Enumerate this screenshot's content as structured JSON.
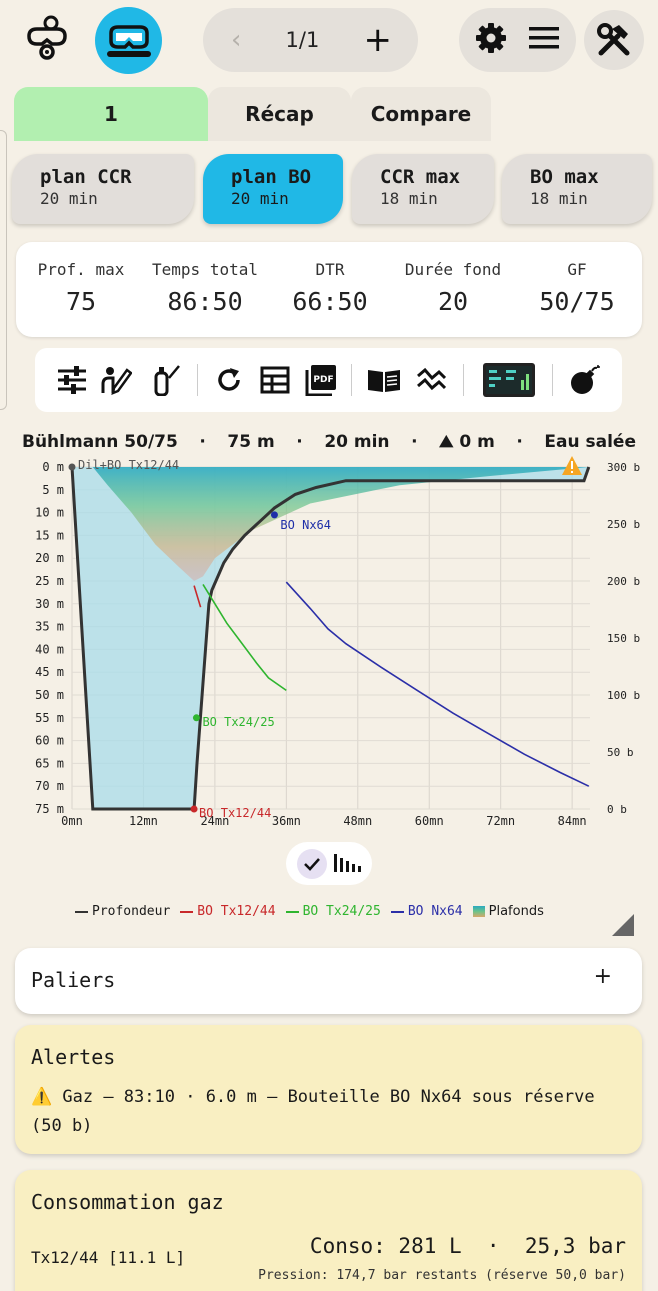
{
  "header": {
    "page_counter": "1/1",
    "prev": "‹",
    "add": "+"
  },
  "tabs": [
    {
      "label": "1",
      "active": true
    },
    {
      "label": "Récap",
      "active": false
    },
    {
      "label": "Compare",
      "active": false
    }
  ],
  "plans": [
    {
      "name": "plan CCR",
      "time": "20 min",
      "active": false
    },
    {
      "name": "plan BO",
      "time": "20 min",
      "active": true
    },
    {
      "name": "CCR max",
      "time": "18 min",
      "active": false
    },
    {
      "name": "BO max",
      "time": "18 min",
      "active": false
    }
  ],
  "stats": [
    {
      "label": "Prof. max",
      "value": "75"
    },
    {
      "label": "Temps total",
      "value": "86:50"
    },
    {
      "label": "DTR",
      "value": "66:50"
    },
    {
      "label": "Durée fond",
      "value": "20"
    },
    {
      "label": "GF",
      "value": "50/75"
    }
  ],
  "chart_header": [
    "Bühlmann 50/75",
    "·",
    "75 m",
    "·",
    "20 min",
    "·",
    "⛰ 0 m",
    "·",
    "Eau salée"
  ],
  "chart_data": {
    "type": "line",
    "x_ticks": [
      "0mn",
      "12mn",
      "24mn",
      "36mn",
      "48mn",
      "60mn",
      "72mn",
      "84mn"
    ],
    "y_ticks_left": [
      "0 m",
      "5 m",
      "10 m",
      "15 m",
      "20 m",
      "25 m",
      "30 m",
      "35 m",
      "40 m",
      "45 m",
      "50 m",
      "55 m",
      "60 m",
      "65 m",
      "70 m",
      "75 m"
    ],
    "y_ticks_right": [
      "300 b",
      "250 b",
      "200 b",
      "150 b",
      "100 b",
      "50 b",
      "0 b"
    ],
    "xlim": [
      0,
      87
    ],
    "ylim_depth": [
      0,
      75
    ],
    "ylim_pressure": [
      0,
      300
    ],
    "series": [
      {
        "name": "Profondeur",
        "color": "#333333",
        "axis": "depth",
        "x": [
          0,
          3.5,
          20.5,
          21,
          23,
          23.5,
          24.5,
          25.5,
          27,
          29,
          31.5,
          34,
          37.5,
          41,
          46,
          52,
          58,
          86,
          86.8
        ],
        "y": [
          0,
          75,
          75,
          65,
          30,
          27,
          24,
          21,
          18,
          15,
          12,
          9,
          6,
          4.5,
          3,
          3,
          3,
          3,
          0
        ]
      },
      {
        "name": "BO Tx12/44",
        "color": "#c8282a",
        "axis": "pressure",
        "x": [
          20.5,
          21.6
        ],
        "y": [
          196,
          177
        ]
      },
      {
        "name": "BO Tx24/25",
        "color": "#2fb52f",
        "axis": "pressure",
        "x": [
          22,
          24,
          26,
          29,
          31,
          33,
          36
        ],
        "y": [
          197,
          180,
          163,
          142,
          128,
          115,
          104
        ]
      },
      {
        "name": "BO Nx64",
        "color": "#2b2fa8",
        "axis": "pressure",
        "x": [
          36,
          40,
          43,
          46,
          52,
          58,
          64,
          70,
          76,
          82,
          86.8
        ],
        "y": [
          199,
          176,
          158,
          145,
          124,
          104,
          84,
          66,
          48,
          32,
          20
        ]
      }
    ],
    "ceiling_label": "Plafonds",
    "markers": [
      {
        "label": "Dil+BO Tx12/44",
        "color": "#555555"
      },
      {
        "label": "BO Nx64",
        "color": "#1f2fa8"
      },
      {
        "label": "BO Tx24/25",
        "color": "#2fb52f"
      },
      {
        "label": "BO Tx12/44",
        "color": "#c8282a"
      }
    ],
    "legend": [
      "Profondeur",
      "BO Tx12/44",
      "BO Tx24/25",
      "BO Nx64",
      "Plafonds"
    ]
  },
  "paliers": {
    "title": "Paliers",
    "toggle": "+"
  },
  "alerts": {
    "title": "Alertes",
    "message": "⚠️ Gaz — 83:10 · 6.0 m — Bouteille BO Nx64 sous réserve (50 b)"
  },
  "conso": {
    "title": "Consommation gaz",
    "gas": "Tx12/44 [11.1 L]",
    "conso": "Conso: 281 L  ·  25,3 bar",
    "pression": "Pression: 174,7 bar restants (réserve 50,0 bar)"
  }
}
